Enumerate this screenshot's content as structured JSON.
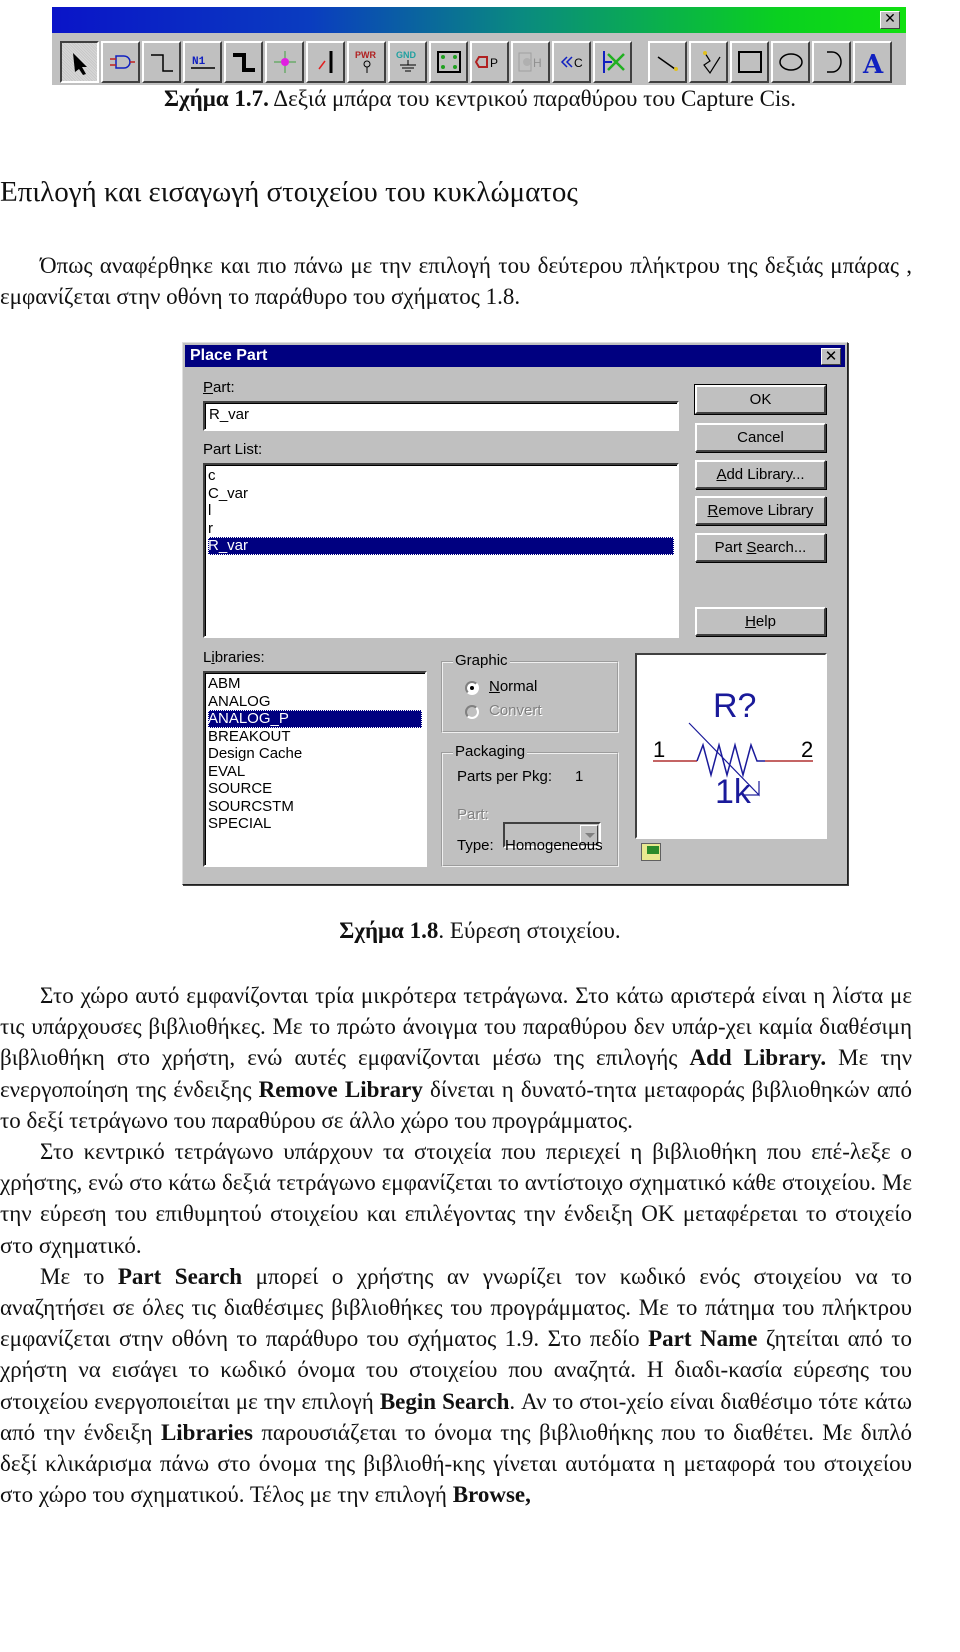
{
  "toolbar_figure": {
    "close_label": "✕",
    "tools": [
      {
        "name": "select-tool",
        "label": "Select"
      },
      {
        "name": "place-part-tool",
        "label": "Place Part"
      },
      {
        "name": "place-wire-tool",
        "label": "Place Wire"
      },
      {
        "name": "place-net-alias-tool",
        "label": "N1"
      },
      {
        "name": "place-bus-tool",
        "label": "Place Bus"
      },
      {
        "name": "place-junction-tool",
        "label": "Place Junction"
      },
      {
        "name": "place-bus-entry-tool",
        "label": "Place Bus Entry"
      },
      {
        "name": "place-power-tool",
        "label": "PWR"
      },
      {
        "name": "place-ground-tool",
        "label": "GND"
      },
      {
        "name": "place-hierarchical-block-tool",
        "label": "Hierarchical Block"
      },
      {
        "name": "place-port-tool",
        "label": "P"
      },
      {
        "name": "place-hierarchical-pin-tool",
        "label": "H"
      },
      {
        "name": "place-off-page-connector-tool",
        "label": "C"
      },
      {
        "name": "place-no-connect-tool",
        "label": "No Connect"
      },
      {
        "name": "place-line-tool",
        "label": "Line"
      },
      {
        "name": "place-polyline-tool",
        "label": "Polyline"
      },
      {
        "name": "place-rectangle-tool",
        "label": "Rectangle"
      },
      {
        "name": "place-ellipse-tool",
        "label": "Ellipse"
      },
      {
        "name": "place-arc-tool",
        "label": "Arc"
      },
      {
        "name": "place-text-tool",
        "label": "A"
      }
    ]
  },
  "captions": {
    "fig17_bold": "Σχήμα 1.7.",
    "fig17_text": " Δεξιά μπάρα του κεντρικού παραθύρου του Capture Cis.",
    "fig18_bold": "Σχήμα 1.8",
    "fig18_text": ". Εύρεση στοιχείου."
  },
  "heading": "Επιλογή και εισαγωγή στοιχείου του κυκλώματος",
  "intro_paragraph": "Όπως αναφέρθηκε και πιο πάνω με την επιλογή του δεύτερου πλήκτρου της δεξιάς μπάρας , εμφανίζεται στην οθόνη το παράθυρο του σχήματος 1.8.",
  "dialog": {
    "title": "Place Part",
    "close_label": "✕",
    "part_label_u": "P",
    "part_label_rest": "art:",
    "part_value": "R_var",
    "part_list_label": "Part List:",
    "part_list": [
      "c",
      "C_var",
      "l",
      "r",
      "R_var"
    ],
    "part_list_selected": 4,
    "libraries_label_pre": "L",
    "libraries_label_u": "i",
    "libraries_label_rest": "braries:",
    "libraries": [
      "ABM",
      "ANALOG",
      "ANALOG_P",
      "BREAKOUT",
      "Design Cache",
      "EVAL",
      "SOURCE",
      "SOURCSTM",
      "SPECIAL"
    ],
    "libraries_selected": 2,
    "buttons": {
      "ok": "OK",
      "cancel": "Cancel",
      "add_library_u": "A",
      "add_library_rest": "dd Library...",
      "remove_library_u": "R",
      "remove_library_rest": "emove Library",
      "part_search_pre": "Part ",
      "part_search_u": "S",
      "part_search_rest": "earch...",
      "help_u": "H",
      "help_rest": "elp"
    },
    "graphic": {
      "title": "Graphic",
      "normal_u": "N",
      "normal_rest": "ormal",
      "convert": "Convert",
      "selected": "Normal"
    },
    "packaging": {
      "title": "Packaging",
      "parts_per_pkg_label": "Parts per Pkg:",
      "parts_per_pkg_value": "1",
      "part_label": "Part:",
      "part_value": "",
      "type_label": "Type:",
      "type_value": "Homogeneous"
    },
    "preview": {
      "refdes": "R?",
      "value": "1k",
      "pin1": "1",
      "pin2": "2",
      "colors": {
        "symbol": "#1a1a9a",
        "pin": "#b03030"
      }
    }
  },
  "paragraphs": [
    {
      "indent": true,
      "parts": [
        {
          "t": "Στο χώρο αυτό εμφανίζονται τρία μικρότερα τετράγωνα. Στο κάτω αριστερά είναι η λίστα με τις υπάρχουσες βιβλιοθήκες. Με το πρώτο άνοιγμα του παραθύρου δεν υπάρ-χει καμία  διαθέσιμη βιβλιοθήκη στο χρήστη, ενώ αυτές εμφανίζονται μέσω της επιλογής "
        },
        {
          "b": "Add Library."
        },
        {
          "t": " Με την ενεργοποίηση της  ένδειξης  "
        },
        {
          "b": "Remove Library"
        },
        {
          "t": " δίνεται η δυνατό-τητα μεταφοράς βιβλιοθηκών από το δεξί τετράγωνο του παραθύρου σε άλλο χώρο του προγράμματος."
        }
      ]
    },
    {
      "indent": true,
      "parts": [
        {
          "t": "Στο κεντρικό τετράγωνο υπάρχουν τα στοιχεία που περιεχεί η βιβλιοθήκη που επέ-λεξε ο χρήστης, ενώ στο κάτω δεξιά  τετράγωνο εμφανίζεται το αντίστοιχο σχηματικό κάθε στοιχείου. Με την εύρεση του επιθυμητού στοιχείου και επιλέγοντας την ένδειξη ΟΚ μεταφέρεται το στοιχείο στο σχηματικό."
        }
      ]
    },
    {
      "indent": true,
      "parts": [
        {
          "t": "Με το "
        },
        {
          "b": "Part Search"
        },
        {
          "t": " μπορεί ο χρήστης αν γνωρίζει τον κωδικό ενός στοιχείου να το αναζητήσει σε όλες τις διαθέσιμες βιβλιοθήκες του προγράμματος. Με το πάτημα του πλήκτρου εμφανίζεται στην οθόνη το παράθυρο του σχήματος 1.9. Στο πεδίο "
        },
        {
          "b": "Part Name"
        },
        {
          "t": " ζητείται από το χρήστη να εισάγει το κωδικό όνομα του στοιχείου που αναζητά. Η διαδι-κασία εύρεσης του στοιχείου ενεργοποιείται με την επιλογή "
        },
        {
          "b": "Begin Search"
        },
        {
          "t": ".  Αν το στοι-χείο είναι  διαθέσιμο τότε κάτω από την ένδειξη "
        },
        {
          "b": "Libraries"
        },
        {
          "t": " παρουσιάζεται το όνομα της βιβλιοθήκης που το διαθέτει. Με διπλό δεξί κλικάρισμα πάνω στο όνομα της βιβλιοθή-κης γίνεται αυτόματα η μεταφορά του στοιχείου στο χώρο του σχηματικού. Τέλος με την επιλογή "
        },
        {
          "b": "Browse,"
        }
      ]
    }
  ]
}
